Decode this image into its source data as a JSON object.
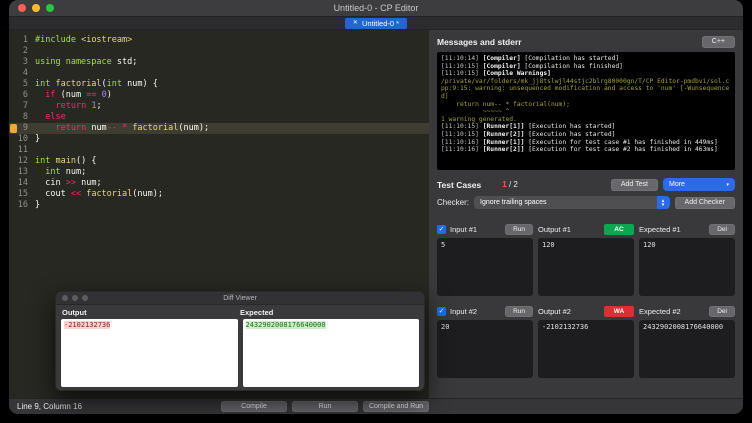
{
  "window": {
    "title": "Untitled-0 - CP Editor",
    "tab_label": "Untitled-0 *",
    "tab_close": "✕"
  },
  "editor": {
    "current_line": 9,
    "lines": [
      {
        "n": "1",
        "s": [
          [
            "#include",
            "g"
          ],
          [
            " ",
            ""
          ],
          [
            "<iostream>",
            "y"
          ]
        ]
      },
      {
        "n": "2",
        "s": []
      },
      {
        "n": "3",
        "s": [
          [
            "using namespace",
            "g"
          ],
          [
            " std;",
            ""
          ]
        ]
      },
      {
        "n": "4",
        "s": []
      },
      {
        "n": "5",
        "s": [
          [
            "int",
            "g"
          ],
          [
            " ",
            ""
          ],
          [
            "factorial",
            "y"
          ],
          [
            "(",
            ""
          ],
          [
            "int",
            "g"
          ],
          [
            " num) {",
            ""
          ]
        ]
      },
      {
        "n": "6",
        "s": [
          [
            "  ",
            ""
          ],
          [
            "if",
            "r"
          ],
          [
            " (num ",
            ""
          ],
          [
            "==",
            "r"
          ],
          [
            " ",
            ""
          ],
          [
            "0",
            "v"
          ],
          [
            ")",
            ""
          ]
        ]
      },
      {
        "n": "7",
        "s": [
          [
            "    ",
            ""
          ],
          [
            "return",
            "r"
          ],
          [
            " ",
            ""
          ],
          [
            "1",
            "v"
          ],
          [
            ";",
            ""
          ]
        ]
      },
      {
        "n": "8",
        "s": [
          [
            "  ",
            ""
          ],
          [
            "else",
            "r"
          ]
        ]
      },
      {
        "n": "9",
        "s": [
          [
            "    ",
            ""
          ],
          [
            "return",
            "r"
          ],
          [
            " num",
            ""
          ],
          [
            "--",
            "r"
          ],
          [
            " ",
            ""
          ],
          [
            "*",
            "r"
          ],
          [
            " ",
            ""
          ],
          [
            "factorial",
            "y"
          ],
          [
            "(num);",
            ""
          ]
        ]
      },
      {
        "n": "10",
        "s": [
          [
            "}",
            ""
          ]
        ]
      },
      {
        "n": "11",
        "s": []
      },
      {
        "n": "12",
        "s": [
          [
            "int",
            "g"
          ],
          [
            " ",
            ""
          ],
          [
            "main",
            "y"
          ],
          [
            "() {",
            ""
          ]
        ]
      },
      {
        "n": "13",
        "s": [
          [
            "  ",
            ""
          ],
          [
            "int",
            "g"
          ],
          [
            " num;",
            ""
          ]
        ]
      },
      {
        "n": "14",
        "s": [
          [
            "  cin ",
            ""
          ],
          [
            ">>",
            "r"
          ],
          [
            " num;",
            ""
          ]
        ]
      },
      {
        "n": "15",
        "s": [
          [
            "  cout ",
            ""
          ],
          [
            "<<",
            "r"
          ],
          [
            " ",
            ""
          ],
          [
            "factorial",
            "y"
          ],
          [
            "(num);",
            ""
          ]
        ]
      },
      {
        "n": "16",
        "s": [
          [
            "}",
            ""
          ]
        ]
      }
    ]
  },
  "statusbar": {
    "position": "Line 9, Column 16",
    "compile": "Compile",
    "run": "Run",
    "compile_and_run": "Compile and Run"
  },
  "messages": {
    "title": "Messages and stderr",
    "language": "C++",
    "log": [
      {
        "type": "info",
        "time": "[11:10:14]",
        "tag": "[Compiler]",
        "msg": "[Compilation has started]"
      },
      {
        "type": "info",
        "time": "[11:10:15]",
        "tag": "[Compiler]",
        "msg": "[Compilation has finished]"
      },
      {
        "type": "info",
        "time": "[11:10:15]",
        "tag": "[Compile Warnings]",
        "msg": ""
      },
      {
        "type": "warn",
        "msg": "/private/var/folders/mk_jj8tslwjl44stjc2blrg80000gn/T/CP Editor-pmdbvi/sol.cpp:9:15: warning: unsequenced modification and access to 'num' [-Wunsequenced]"
      },
      {
        "type": "warn",
        "msg": "    return num-- * factorial(num);"
      },
      {
        "type": "warn",
        "msg": "           ~~~~~ ^"
      },
      {
        "type": "warn",
        "msg": "1 warning generated."
      },
      {
        "type": "info",
        "time": "[11:10:15]",
        "tag": "[Runner[1]]",
        "msg": "[Execution has started]"
      },
      {
        "type": "info",
        "time": "[11:10:15]",
        "tag": "[Runner[2]]",
        "msg": "[Execution has started]"
      },
      {
        "type": "info",
        "time": "[11:10:16]",
        "tag": "[Runner[1]]",
        "msg": "[Execution for test case #1 has finished in 449ms]"
      },
      {
        "type": "info",
        "time": "[11:10:16]",
        "tag": "[Runner[2]]",
        "msg": "[Execution for test case #2 has finished in 463ms]"
      }
    ]
  },
  "testcases": {
    "title": "Test Cases",
    "passed": "1",
    "separator": " / ",
    "total": "2",
    "add_test": "Add Test",
    "more": "More",
    "more_arrow": "▾",
    "checker_label": "Checker:",
    "checker_value": "Ignore trailing spaces",
    "add_checker": "Add Checker",
    "checkbox_glyph": "✓",
    "cases": [
      {
        "input_label": "Input #1",
        "run": "Run",
        "output_label": "Output #1",
        "verdict": "AC",
        "expected_label": "Expected #1",
        "del": "Del",
        "input": "5",
        "output": "120",
        "expected": "120"
      },
      {
        "input_label": "Input #2",
        "run": "Run",
        "output_label": "Output #2",
        "verdict": "WA",
        "expected_label": "Expected #2",
        "del": "Del",
        "input": "20",
        "output": "-2102132736",
        "expected": "2432902008176640000"
      }
    ]
  },
  "diff_viewer": {
    "title": "Diff Viewer",
    "output_label": "Output",
    "expected_label": "Expected",
    "output_value": "-2102132736",
    "expected_value": "2432902008176640000"
  }
}
